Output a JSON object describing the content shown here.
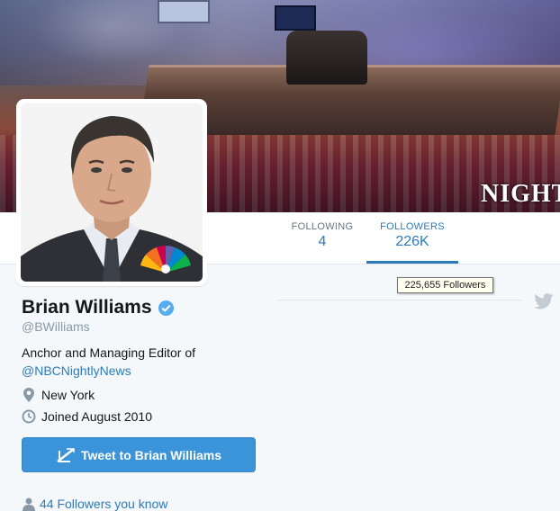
{
  "profile": {
    "name": "Brian Williams",
    "handle": "@BWilliams",
    "bio_text": "Anchor and Managing Editor of",
    "bio_link": "@NBCNightlyNews",
    "location": "New York",
    "joined": "Joined August 2010",
    "verified": true
  },
  "stats": {
    "following_label": "FOLLOWING",
    "following_value": "4",
    "followers_label": "FOLLOWERS",
    "followers_value": "226K",
    "followers_tooltip": "225,655 Followers"
  },
  "actions": {
    "tweet_to_label": "Tweet to Brian Williams",
    "followers_you_know": "44 Followers you know"
  },
  "header": {
    "banner_text": "NIGHTL"
  },
  "colors": {
    "accent": "#2b7bb9",
    "button": "#3b94d9",
    "background": "#f5f8fa"
  },
  "icons": [
    "verified-badge-icon",
    "location-pin-icon",
    "calendar-clock-icon",
    "tweet-compose-icon",
    "person-icon",
    "twitter-bird-icon",
    "nbc-peacock-logo"
  ]
}
